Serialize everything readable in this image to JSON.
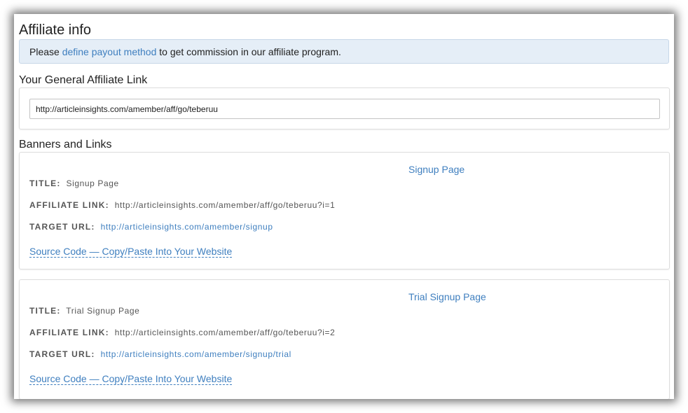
{
  "page": {
    "title": "Affiliate info"
  },
  "notice": {
    "prefix": "Please",
    "link_text": "define payout method",
    "suffix": "to get commission in our affiliate program."
  },
  "general_link": {
    "heading": "Your General Affiliate Link",
    "value": "http://articleinsights.com/amember/aff/go/teberuu"
  },
  "banners": {
    "heading": "Banners and Links",
    "field_labels": {
      "title": "TITLE:",
      "affiliate_link": "AFFILIATE LINK:",
      "target_url": "TARGET URL:"
    },
    "source_code_label": "Source Code — Copy/Paste Into Your Website",
    "items": [
      {
        "heading": "Signup Page",
        "title": "Signup Page",
        "affiliate_link": "http://articleinsights.com/amember/aff/go/teberuu?i=1",
        "target_url": "http://articleinsights.com/amember/signup"
      },
      {
        "heading": "Trial Signup Page",
        "title": "Trial Signup Page",
        "affiliate_link": "http://articleinsights.com/amember/aff/go/teberuu?i=2",
        "target_url": "http://articleinsights.com/amember/signup/trial"
      }
    ]
  },
  "colors": {
    "link": "#3f7fbf",
    "notice_bg": "#e5eef7",
    "panel_border": "#dddddd"
  }
}
